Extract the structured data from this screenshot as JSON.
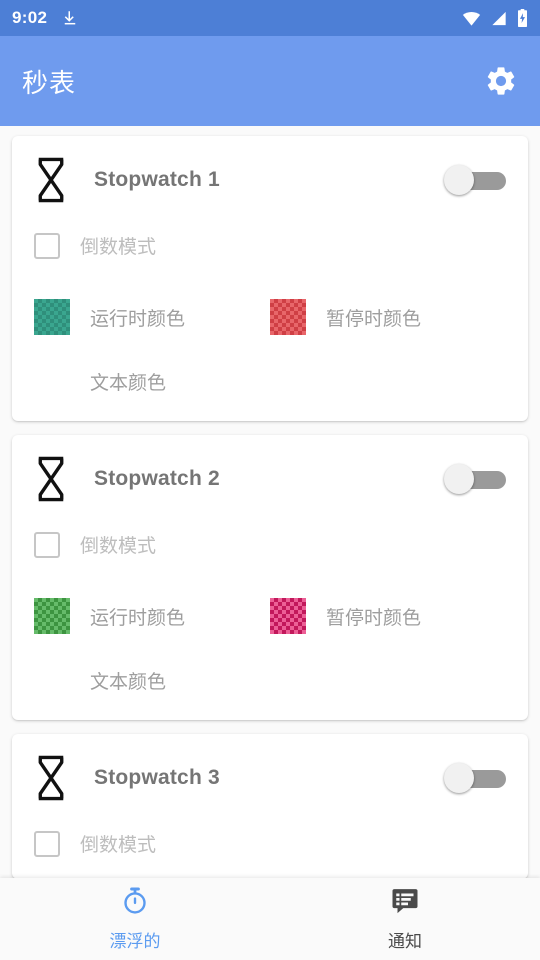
{
  "status_bar": {
    "time": "9:02",
    "icons": [
      "download-icon",
      "wifi-icon",
      "signal-icon",
      "battery-charging-icon"
    ],
    "background": "#4d7fd6"
  },
  "app_bar": {
    "title": "秒表",
    "settings_icon": "gear-icon",
    "background": "#6f9bee",
    "title_color": "#ffffff"
  },
  "labels": {
    "countdown_mode": "倒数模式",
    "running_color": "运行时颜色",
    "paused_color": "暂停时颜色",
    "text_color": "文本颜色"
  },
  "cards": [
    {
      "icon": "hourglass-icon",
      "title": "Stopwatch 1",
      "enabled": false,
      "countdown_checked": false,
      "running_swatch": "#3aa68f",
      "running_swatch_alt": "#2f8f7b",
      "paused_swatch": "#e8666a",
      "paused_swatch_alt": "#cf3f45",
      "text_swatch": "#ffffff"
    },
    {
      "icon": "hourglass-icon",
      "title": "Stopwatch 2",
      "enabled": false,
      "countdown_checked": false,
      "running_swatch": "#66bb6a",
      "running_swatch_alt": "#3d9440",
      "paused_swatch": "#ec5f96",
      "paused_swatch_alt": "#c2185b",
      "text_swatch": "#ffffff"
    },
    {
      "icon": "hourglass-icon",
      "title": "Stopwatch 3",
      "enabled": false,
      "countdown_checked": false,
      "running_swatch": "#9e9e9e",
      "running_swatch_alt": "#757575",
      "paused_swatch": "#9e9e9e",
      "paused_swatch_alt": "#757575",
      "text_swatch": "#ffffff"
    }
  ],
  "bottom_nav": {
    "items": [
      {
        "label": "漂浮的",
        "icon": "stopwatch-icon",
        "active": true,
        "color": "#5b9bf0"
      },
      {
        "label": "通知",
        "icon": "comment-list-icon",
        "active": false,
        "color": "#4a4a4a"
      }
    ]
  }
}
